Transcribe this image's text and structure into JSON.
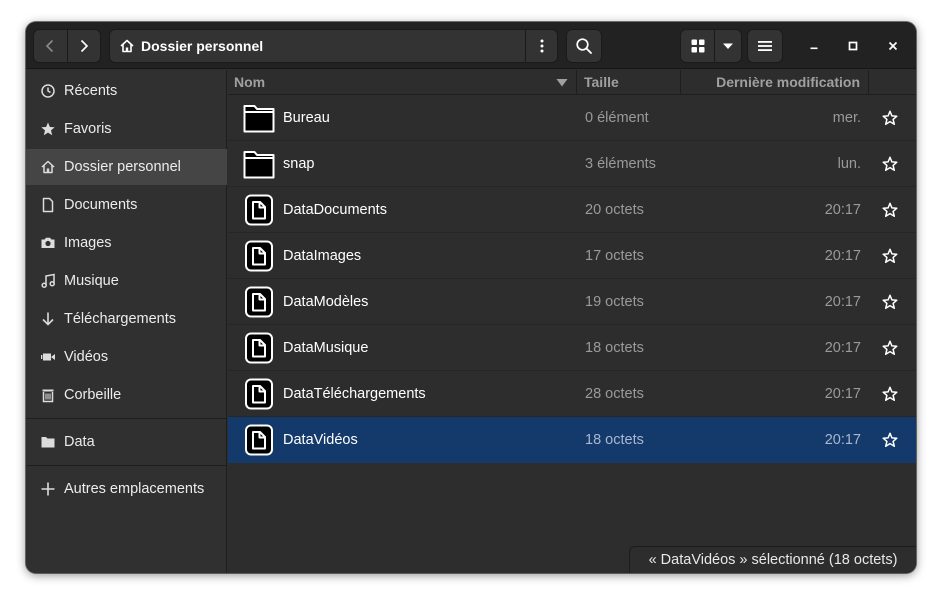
{
  "header": {
    "path_label": "Dossier personnel"
  },
  "sidebar": {
    "items": [
      {
        "label": "Récents",
        "icon": "clock-icon"
      },
      {
        "label": "Favoris",
        "icon": "star-icon"
      },
      {
        "label": "Dossier personnel",
        "icon": "home-icon"
      },
      {
        "label": "Documents",
        "icon": "document-icon"
      },
      {
        "label": "Images",
        "icon": "camera-icon"
      },
      {
        "label": "Musique",
        "icon": "music-icon"
      },
      {
        "label": "Téléchargements",
        "icon": "download-icon"
      },
      {
        "label": "Vidéos",
        "icon": "video-icon"
      },
      {
        "label": "Corbeille",
        "icon": "trash-icon"
      }
    ],
    "devices": [
      {
        "label": "Data",
        "icon": "folder-icon"
      }
    ],
    "other": {
      "label": "Autres emplacements",
      "icon": "plus-icon"
    }
  },
  "columns": {
    "name": "Nom",
    "size": "Taille",
    "modified": "Dernière modification"
  },
  "files": [
    {
      "name": "Bureau",
      "size": "0 élément",
      "modified": "mer.",
      "type": "folder"
    },
    {
      "name": "snap",
      "size": "3 éléments",
      "modified": "lun.",
      "type": "folder"
    },
    {
      "name": "DataDocuments",
      "size": "20 octets",
      "modified": "20:17",
      "type": "file"
    },
    {
      "name": "DataImages",
      "size": "17 octets",
      "modified": "20:17",
      "type": "file"
    },
    {
      "name": "DataModèles",
      "size": "19 octets",
      "modified": "20:17",
      "type": "file"
    },
    {
      "name": "DataMusique",
      "size": "18 octets",
      "modified": "20:17",
      "type": "file"
    },
    {
      "name": "DataTéléchargements",
      "size": "28 octets",
      "modified": "20:17",
      "type": "file"
    },
    {
      "name": "DataVidéos",
      "size": "18 octets",
      "modified": "20:17",
      "type": "file",
      "selected": true
    }
  ],
  "status": {
    "text": "« DataVidéos » sélectionné  (18 octets)"
  },
  "colors": {
    "selection": "#133a6b",
    "window_bg": "#2d2d2d",
    "header_bg": "#222222"
  }
}
